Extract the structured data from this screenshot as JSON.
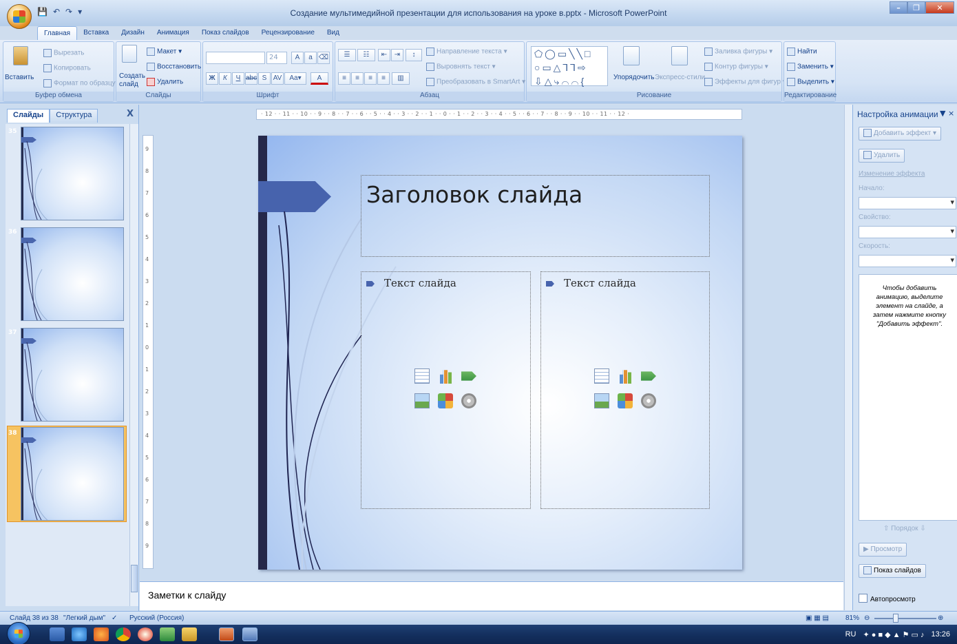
{
  "window": {
    "title": "Создание мультимедийной презентации для использования на уроке в.pptx - Microsoft PowerPoint"
  },
  "ribbon_tabs": [
    "Главная",
    "Вставка",
    "Дизайн",
    "Анимация",
    "Показ слайдов",
    "Рецензирование",
    "Вид"
  ],
  "ribbon": {
    "clipboard": {
      "label": "Буфер обмена",
      "paste": "Вставить",
      "cut": "Вырезать",
      "copy": "Копировать",
      "format_painter": "Формат по образцу"
    },
    "slides": {
      "label": "Слайды",
      "new_slide": "Создать слайд",
      "layout": "Макет",
      "reset": "Восстановить",
      "delete": "Удалить"
    },
    "font": {
      "label": "Шрифт",
      "font_name": "",
      "font_size": "24"
    },
    "paragraph": {
      "label": "Абзац",
      "text_direction": "Направление текста",
      "align_text": "Выровнять текст",
      "convert_smartart": "Преобразовать в SmartArt"
    },
    "drawing": {
      "label": "Рисование",
      "arrange": "Упорядочить",
      "quick_styles": "Экспресс-стили",
      "shape_fill": "Заливка фигуры",
      "shape_outline": "Контур фигуры",
      "shape_effects": "Эффекты для фигур"
    },
    "editing": {
      "label": "Редактирование",
      "find": "Найти",
      "replace": "Заменить",
      "select": "Выделить"
    }
  },
  "left_pane": {
    "tabs": [
      "Слайды",
      "Структура"
    ],
    "close_glyph": "X",
    "thumbnails": [
      {
        "number": "35",
        "selected": false
      },
      {
        "number": "36",
        "selected": false
      },
      {
        "number": "37",
        "selected": false
      },
      {
        "number": "38",
        "selected": true
      }
    ]
  },
  "ruler": {
    "horizontal": "· 12 · · 11 · · 10 · · 9 · · 8 · · 7 · · 6 · · 5 · · 4 · · 3 · · 2 · · 1 · · 0 · · 1 · · 2 · · 3 · · 4 · · 5 · · 6 · · 7 · · 8 · · 9 · · 10 · · 11 · · 12 ·",
    "vertical": [
      "9",
      "8",
      "7",
      "6",
      "5",
      "4",
      "3",
      "2",
      "1",
      "0",
      "1",
      "2",
      "3",
      "4",
      "5",
      "6",
      "7",
      "8",
      "9"
    ]
  },
  "slide": {
    "title": "Заголовок слайда",
    "left_text": "Текст слайда",
    "right_text": "Текст слайда"
  },
  "notes": {
    "placeholder": "Заметки к слайду"
  },
  "animation_pane": {
    "title": "Настройка анимации",
    "add_effect": "Добавить эффект",
    "remove": "Удалить",
    "change_effect": "Изменение эффекта",
    "start_label": "Начало:",
    "property_label": "Свойство:",
    "speed_label": "Скорость:",
    "hint": "Чтобы добавить анимацию, выделите элемент на слайде, а затем нажмите кнопку \"Добавить эффект\".",
    "order_label": "Порядок",
    "preview": "Просмотр",
    "slideshow": "Показ слайдов",
    "autopreview": "Автопросмотр"
  },
  "statusbar": {
    "slide_info": "Слайд 38 из 38",
    "theme": "\"Легкий дым\"",
    "language": "Русский (Россия)",
    "zoom": "81%"
  },
  "taskbar": {
    "lang": "RU",
    "time": "13:26"
  },
  "colors": {
    "accent": "#4763ad",
    "dark_bar": "#25284a",
    "selection": "#f6c361"
  }
}
